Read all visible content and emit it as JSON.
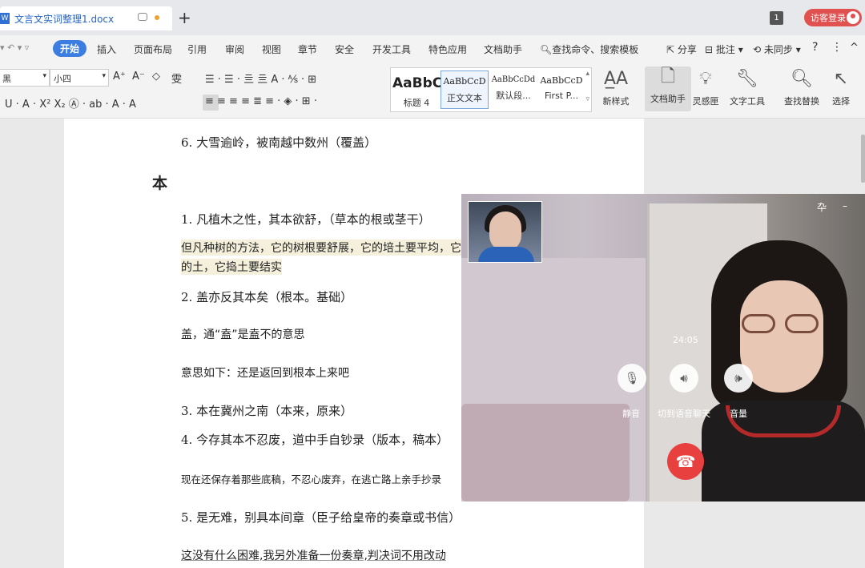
{
  "tabbar": {
    "doc_icon": "W",
    "doc_name": "文言文实词整理1.docx",
    "new_tab": "+",
    "page_count": "1",
    "guest_login": "访客登录"
  },
  "menubar": {
    "quick_access": "▾  ↶  ▾  ▿",
    "items": [
      "开始",
      "插入",
      "页面布局",
      "引用",
      "审阅",
      "视图",
      "章节",
      "安全",
      "开发工具",
      "特色应用",
      "文档助手",
      "查找命令、搜索模板"
    ],
    "right_items": [
      "分享",
      "批注",
      "未同步"
    ],
    "help": "?",
    "more": "⋮",
    "collapse": "^"
  },
  "ribbon": {
    "font_name": "黑",
    "font_size": "小四",
    "grow_font": "A⁺",
    "shrink_font": "A⁻",
    "clear_format": "◇",
    "phonetic": "雯",
    "format_row": "U · A · X² X₂ Ⓐ · ab · A · A",
    "para_row1": "☰ · ☰ · 亖 亖 A · ⅍ · ⊞",
    "para_row2": "≡  ≡  ≡  ≡  ≣  ≡ ·  ◈ · ⊞ ·",
    "styles": [
      {
        "sample": "AaBbC",
        "name": "标题 4"
      },
      {
        "sample": "AaBbCcD",
        "name": "正文文本"
      },
      {
        "sample": "AaBbCcDd",
        "name": "默认段..."
      },
      {
        "sample": "AaBbCcD",
        "name": "First P..."
      }
    ],
    "new_style": "新样式",
    "tools": [
      "文档助手",
      "灵感匣",
      "文字工具",
      "查找替换",
      "选择"
    ]
  },
  "document": {
    "lines": [
      "6. 大雪逾岭，被南越中数州（覆盖）",
      "本",
      "1. 凡植木之性，其本欲舒，（草本的根或茎干）",
      "但凡种树的方法，它的树根要舒展，它的培土要平均，它根下的",
      "的土，它捣土要结实",
      "2. 盖亦反其本矣（根本。基础）",
      "盖，通“盍”是盍不的意思",
      "意思如下：还是返回到根本上来吧",
      "3. 本在冀州之南（本来，原来）",
      "4. 今存其本不忍废，道中手自钞录（版本，稿本）",
      "现在还保存着那些底稿，不忍心废弃，在逃亡路上亲手抄录",
      "5. 是无难，别具本间章（臣子给皇帝的奏章或书信）",
      "这没有什么困难,我另外准备一份奏章,判决词不用改动"
    ]
  },
  "video_call": {
    "top_controls": [
      "卆",
      "–"
    ],
    "timer": "24:05",
    "controls": [
      "静音",
      "切到语音聊天",
      "音量"
    ]
  }
}
